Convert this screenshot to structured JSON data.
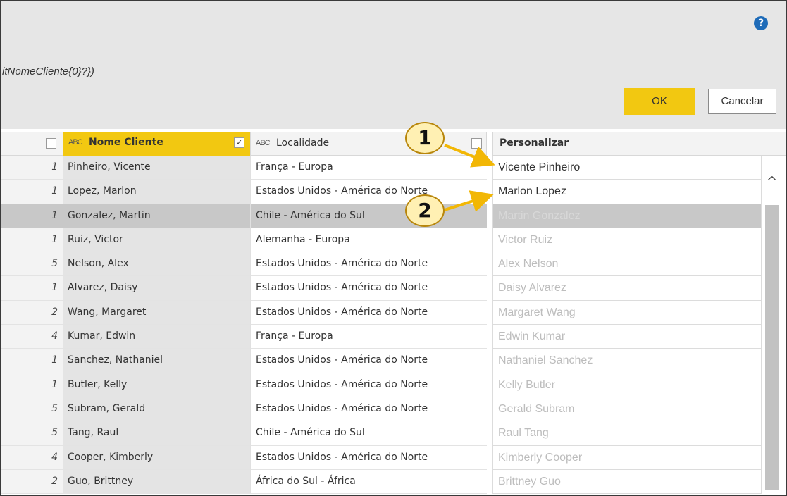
{
  "dialog": {
    "formula_fragment": "itNomeCliente{0}?})",
    "ok_label": "OK",
    "cancel_label": "Cancelar",
    "help_icon": "question-circle-icon",
    "help_glyph": "?"
  },
  "columns": {
    "type_icon_text": "ABC",
    "nome_header": "Nome Cliente",
    "localidade_header": "Localidade",
    "personalizar_header": "Personalizar",
    "nome_checked": true,
    "check_glyph": "✓"
  },
  "rows": [
    {
      "idx": "1",
      "nome": "Pinheiro, Vicente",
      "localidade": "França - Europa"
    },
    {
      "idx": "1",
      "nome": "Lopez, Marlon",
      "localidade": "Estados Unidos - América do Norte"
    },
    {
      "idx": "1",
      "nome": "Gonzalez, Martin",
      "localidade": "Chile - América do Sul"
    },
    {
      "idx": "1",
      "nome": "Ruiz, Victor",
      "localidade": "Alemanha - Europa"
    },
    {
      "idx": "5",
      "nome": "Nelson, Alex",
      "localidade": "Estados Unidos - América do Norte"
    },
    {
      "idx": "1",
      "nome": "Alvarez, Daisy",
      "localidade": "Estados Unidos - América do Norte"
    },
    {
      "idx": "2",
      "nome": "Wang, Margaret",
      "localidade": "Estados Unidos - América do Norte"
    },
    {
      "idx": "4",
      "nome": "Kumar, Edwin",
      "localidade": "França - Europa"
    },
    {
      "idx": "1",
      "nome": "Sanchez, Nathaniel",
      "localidade": "Estados Unidos - América do Norte"
    },
    {
      "idx": "1",
      "nome": "Butler, Kelly",
      "localidade": "Estados Unidos - América do Norte"
    },
    {
      "idx": "5",
      "nome": "Subram, Gerald",
      "localidade": "Estados Unidos - América do Norte"
    },
    {
      "idx": "5",
      "nome": "Tang, Raul",
      "localidade": "Chile - América do Sul"
    },
    {
      "idx": "4",
      "nome": "Cooper, Kimberly",
      "localidade": "Estados Unidos - América do Norte"
    },
    {
      "idx": "2",
      "nome": "Guo, Brittney",
      "localidade": "África do Sul - África"
    }
  ],
  "personalizar": [
    "Vicente Pinheiro",
    "Marlon Lopez",
    "Martin Gonzalez",
    "Victor Ruiz",
    "Alex Nelson",
    "Daisy Alvarez",
    "Margaret Wang",
    "Edwin Kumar",
    "Nathaniel Sanchez",
    "Kelly Butler",
    "Gerald Subram",
    "Raul Tang",
    "Kimberly Cooper",
    "Brittney Guo"
  ],
  "selected_row_index": 2,
  "scroll_up_glyph": "^",
  "callouts": [
    "1",
    "2"
  ],
  "colors": {
    "accent": "#f2c811",
    "callout_fill": "#fff0b3",
    "arrow": "#f2b705"
  }
}
